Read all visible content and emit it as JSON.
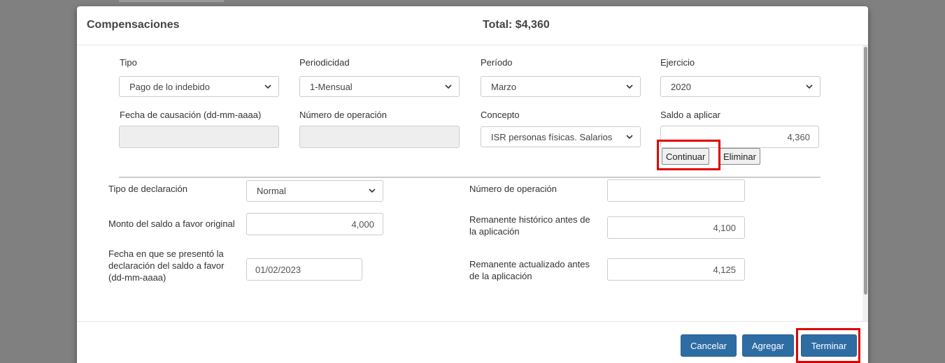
{
  "header": {
    "title": "Compensaciones",
    "total": "Total: $4,360"
  },
  "compensacion": {
    "tipo": {
      "label": "Tipo",
      "value": "Pago de lo indebido"
    },
    "periodicidad": {
      "label": "Periodicidad",
      "value": "1-Mensual"
    },
    "periodo": {
      "label": "Período",
      "value": "Marzo"
    },
    "ejercicio": {
      "label": "Ejercicio",
      "value": "2020"
    },
    "fecha_causacion": {
      "label": "Fecha de causación (dd-mm-aaaa)",
      "value": ""
    },
    "numero_operacion": {
      "label": "Número de operación",
      "value": ""
    },
    "concepto": {
      "label": "Concepto",
      "value": "ISR personas físicas. Salarios"
    },
    "saldo_aplicar": {
      "label": "Saldo a aplicar",
      "value": "4,360"
    },
    "continuar_label": "Continuar",
    "eliminar_label": "Eliminar"
  },
  "saldo_favor": {
    "tipo_declaracion": {
      "label": "Tipo de declaración",
      "value": "Normal"
    },
    "numero_operacion": {
      "label": "Número de operación",
      "value": ""
    },
    "monto_original": {
      "label": "Monto del saldo a favor original",
      "value": "4,000"
    },
    "remanente_historico": {
      "label_line1": "Remanente histórico antes de",
      "label_line2": "la aplicación",
      "value": "4,100"
    },
    "fecha_presentacion": {
      "label_line1": "Fecha en que se presentó la",
      "label_line2": "declaración del saldo a favor",
      "label_line3": "(dd-mm-aaaa)",
      "value": "01/02/2023"
    },
    "remanente_actualizado": {
      "label_line1": "Remanente actualizado antes",
      "label_line2": "de la aplicación",
      "value": "4,125"
    }
  },
  "footer": {
    "cancelar": "Cancelar",
    "agregar": "Agregar",
    "terminar": "Terminar"
  },
  "colors": {
    "primary_button": "#2e6da4",
    "highlight": "#e00000",
    "backdrop": "#808080"
  }
}
